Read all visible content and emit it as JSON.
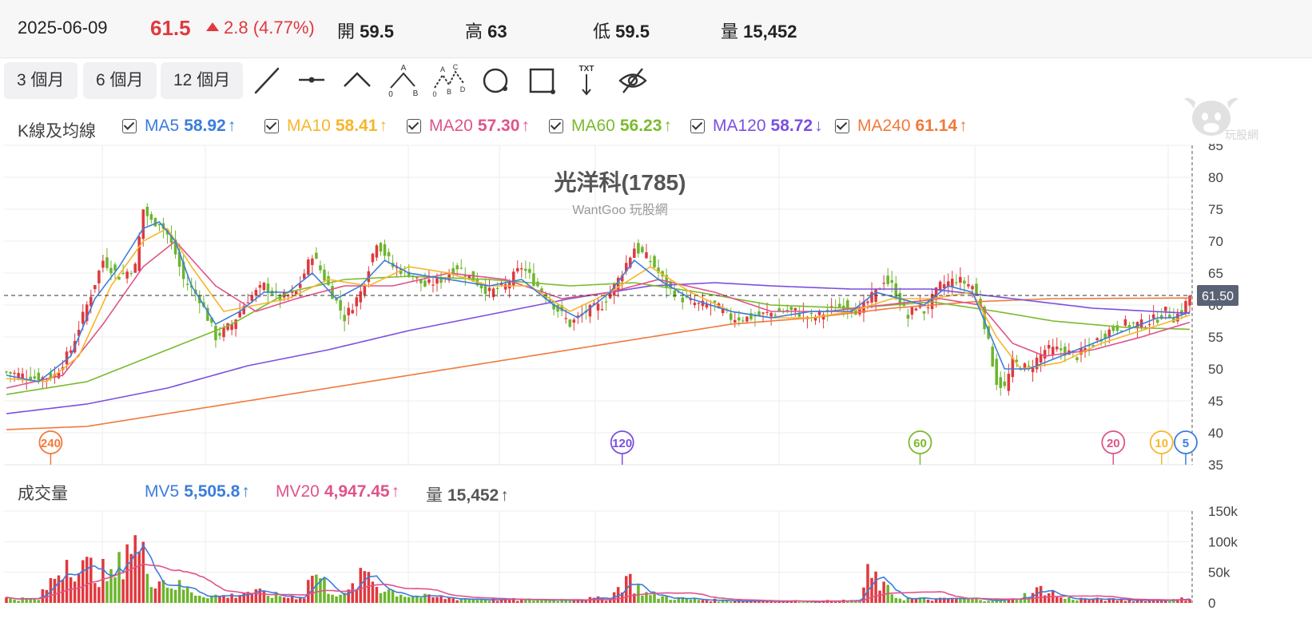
{
  "quote": {
    "date": "2025-06-09",
    "price": "61.5",
    "change": "2.8 (4.77%)",
    "open_label": "開",
    "open": "59.5",
    "high_label": "高",
    "high": "63",
    "low_label": "低",
    "low": "59.5",
    "volume_label": "量",
    "volume": "15,452"
  },
  "periods": [
    "3 個月",
    "6 個月",
    "12 個月"
  ],
  "tools": [
    "line-tool-icon",
    "horizontal-line-tool-icon",
    "angle-tool-icon",
    "abc-pattern-tool-icon",
    "abcd-pattern-tool-icon",
    "circle-tool-icon",
    "rectangle-tool-icon",
    "text-annotation-tool-icon",
    "hide-drawings-icon"
  ],
  "tool_text": {
    "a": "A",
    "b": "B",
    "c": "C",
    "d": "D",
    "zero": "0",
    "txt": "TXT"
  },
  "legend": {
    "title": "K線及均線",
    "items": [
      {
        "name": "MA5",
        "value": "58.92",
        "arrow": "↑",
        "color": "#3b7ddd"
      },
      {
        "name": "MA10",
        "value": "58.41",
        "arrow": "↑",
        "color": "#f5b72b"
      },
      {
        "name": "MA20",
        "value": "57.30",
        "arrow": "↑",
        "color": "#e0538b"
      },
      {
        "name": "MA60",
        "value": "56.23",
        "arrow": "↑",
        "color": "#7cba2f"
      },
      {
        "name": "MA120",
        "value": "58.72",
        "arrow": "↓",
        "color": "#7b4fe0"
      },
      {
        "name": "MA240",
        "value": "61.14",
        "arrow": "↑",
        "color": "#f07a3c"
      }
    ]
  },
  "watermark": {
    "title": "光洋科(1785)",
    "subtitle": "WantGoo 玩股網",
    "logo_text": "玩股網"
  },
  "colors": {
    "up": "#e0393e",
    "down": "#6cb52d",
    "grid": "#eeeeee",
    "price_tag_bg": "#5a6275"
  },
  "chart_data": {
    "type": "candlestick",
    "price_axis": {
      "ticks": [
        "85",
        "80",
        "75",
        "70",
        "65",
        "60",
        "55",
        "50",
        "45",
        "40",
        "35"
      ],
      "range": [
        35,
        85
      ]
    },
    "volume_axis": {
      "ticks": [
        "150k",
        "100k",
        "50k",
        "0"
      ],
      "range": [
        0,
        150000
      ]
    },
    "last_price_tag": "61.50",
    "ma_markers": [
      {
        "label": "240",
        "color": "#f07a3c"
      },
      {
        "label": "120",
        "color": "#7b4fe0"
      },
      {
        "label": "60",
        "color": "#7cba2f"
      },
      {
        "label": "20",
        "color": "#e0538b"
      },
      {
        "label": "10",
        "color": "#f5b72b"
      },
      {
        "label": "5",
        "color": "#3b7ddd"
      }
    ],
    "close_keypoints": [
      [
        0,
        49.5
      ],
      [
        8,
        48.5
      ],
      [
        12,
        49
      ],
      [
        16,
        53
      ],
      [
        20,
        60
      ],
      [
        24,
        67
      ],
      [
        28,
        64.5
      ],
      [
        32,
        66
      ],
      [
        34,
        75
      ],
      [
        36,
        73
      ],
      [
        38,
        73
      ],
      [
        40,
        71
      ],
      [
        42,
        68
      ],
      [
        44,
        64
      ],
      [
        48,
        61
      ],
      [
        52,
        55
      ],
      [
        56,
        57
      ],
      [
        60,
        61
      ],
      [
        64,
        63
      ],
      [
        68,
        61
      ],
      [
        72,
        62
      ],
      [
        76,
        68
      ],
      [
        80,
        63
      ],
      [
        84,
        58
      ],
      [
        88,
        62
      ],
      [
        92,
        70
      ],
      [
        96,
        66
      ],
      [
        100,
        65
      ],
      [
        104,
        63
      ],
      [
        108,
        64
      ],
      [
        112,
        66
      ],
      [
        116,
        64
      ],
      [
        120,
        62
      ],
      [
        124,
        63
      ],
      [
        128,
        66
      ],
      [
        132,
        63
      ],
      [
        136,
        60
      ],
      [
        140,
        57
      ],
      [
        144,
        59
      ],
      [
        148,
        60
      ],
      [
        152,
        64
      ],
      [
        156,
        69
      ],
      [
        160,
        67
      ],
      [
        164,
        63
      ],
      [
        168,
        61
      ],
      [
        172,
        60
      ],
      [
        176,
        60
      ],
      [
        180,
        58
      ],
      [
        184,
        58
      ],
      [
        188,
        58.5
      ],
      [
        192,
        59
      ],
      [
        196,
        59
      ],
      [
        200,
        58
      ],
      [
        204,
        59
      ],
      [
        208,
        60
      ],
      [
        212,
        59
      ],
      [
        216,
        62
      ],
      [
        218,
        64
      ],
      [
        220,
        63
      ],
      [
        224,
        58
      ],
      [
        226,
        60
      ],
      [
        228,
        59
      ],
      [
        232,
        63
      ],
      [
        236,
        64
      ],
      [
        240,
        63
      ],
      [
        242,
        60
      ],
      [
        244,
        54
      ],
      [
        246,
        48
      ],
      [
        248,
        47
      ],
      [
        250,
        51
      ],
      [
        254,
        50
      ],
      [
        258,
        53
      ],
      [
        262,
        53
      ],
      [
        266,
        52
      ],
      [
        270,
        54
      ],
      [
        274,
        56
      ],
      [
        278,
        57
      ],
      [
        282,
        57
      ],
      [
        286,
        58
      ],
      [
        288,
        59
      ],
      [
        290,
        58
      ],
      [
        292,
        59
      ],
      [
        294,
        61.5
      ]
    ],
    "ma5": [
      [
        0,
        49
      ],
      [
        8,
        48
      ],
      [
        16,
        52
      ],
      [
        22,
        61
      ],
      [
        28,
        66
      ],
      [
        34,
        72
      ],
      [
        38,
        73
      ],
      [
        42,
        70
      ],
      [
        46,
        63
      ],
      [
        52,
        57
      ],
      [
        58,
        59
      ],
      [
        64,
        62
      ],
      [
        70,
        62
      ],
      [
        76,
        65
      ],
      [
        82,
        61
      ],
      [
        88,
        63
      ],
      [
        94,
        67
      ],
      [
        100,
        65
      ],
      [
        110,
        64
      ],
      [
        120,
        63
      ],
      [
        128,
        64
      ],
      [
        136,
        60
      ],
      [
        142,
        58
      ],
      [
        150,
        62
      ],
      [
        156,
        67
      ],
      [
        162,
        64
      ],
      [
        170,
        61
      ],
      [
        180,
        59
      ],
      [
        190,
        58
      ],
      [
        200,
        59
      ],
      [
        210,
        59
      ],
      [
        216,
        62
      ],
      [
        222,
        61
      ],
      [
        228,
        60
      ],
      [
        234,
        63
      ],
      [
        240,
        62
      ],
      [
        244,
        56
      ],
      [
        248,
        50
      ],
      [
        254,
        50
      ],
      [
        262,
        52
      ],
      [
        270,
        54
      ],
      [
        278,
        56
      ],
      [
        286,
        58
      ],
      [
        290,
        58
      ],
      [
        294,
        58.9
      ]
    ],
    "ma10": [
      [
        0,
        48.5
      ],
      [
        10,
        48
      ],
      [
        18,
        52
      ],
      [
        26,
        63
      ],
      [
        34,
        70
      ],
      [
        40,
        72
      ],
      [
        46,
        66
      ],
      [
        54,
        59
      ],
      [
        62,
        60
      ],
      [
        70,
        61
      ],
      [
        80,
        64
      ],
      [
        90,
        63
      ],
      [
        100,
        66
      ],
      [
        110,
        65
      ],
      [
        120,
        63
      ],
      [
        130,
        63
      ],
      [
        140,
        59
      ],
      [
        150,
        62
      ],
      [
        160,
        66
      ],
      [
        170,
        62
      ],
      [
        180,
        59
      ],
      [
        190,
        58
      ],
      [
        200,
        58
      ],
      [
        210,
        59
      ],
      [
        220,
        61
      ],
      [
        230,
        61
      ],
      [
        240,
        62
      ],
      [
        246,
        55
      ],
      [
        252,
        50
      ],
      [
        262,
        51
      ],
      [
        272,
        54
      ],
      [
        282,
        56
      ],
      [
        294,
        58.4
      ]
    ],
    "ma20": [
      [
        0,
        47
      ],
      [
        14,
        49
      ],
      [
        24,
        57
      ],
      [
        34,
        66
      ],
      [
        42,
        70
      ],
      [
        52,
        63
      ],
      [
        62,
        59
      ],
      [
        72,
        61
      ],
      [
        84,
        63
      ],
      [
        96,
        63
      ],
      [
        110,
        65
      ],
      [
        124,
        64
      ],
      [
        138,
        61
      ],
      [
        150,
        62
      ],
      [
        162,
        64
      ],
      [
        176,
        62
      ],
      [
        190,
        59
      ],
      [
        204,
        59
      ],
      [
        218,
        60
      ],
      [
        232,
        61
      ],
      [
        242,
        60
      ],
      [
        250,
        54
      ],
      [
        258,
        52
      ],
      [
        270,
        53
      ],
      [
        282,
        55
      ],
      [
        294,
        57.3
      ]
    ],
    "ma60": [
      [
        0,
        46
      ],
      [
        20,
        48
      ],
      [
        40,
        53
      ],
      [
        56,
        57
      ],
      [
        70,
        62
      ],
      [
        84,
        64
      ],
      [
        100,
        64.5
      ],
      [
        120,
        64
      ],
      [
        140,
        63
      ],
      [
        156,
        63.5
      ],
      [
        172,
        62
      ],
      [
        190,
        60
      ],
      [
        210,
        59.5
      ],
      [
        230,
        60.5
      ],
      [
        246,
        59
      ],
      [
        260,
        57.5
      ],
      [
        278,
        56.5
      ],
      [
        294,
        56.2
      ]
    ],
    "ma120": [
      [
        0,
        43
      ],
      [
        20,
        44.5
      ],
      [
        40,
        47
      ],
      [
        60,
        50.5
      ],
      [
        80,
        53
      ],
      [
        100,
        56
      ],
      [
        120,
        58.5
      ],
      [
        140,
        61
      ],
      [
        160,
        63
      ],
      [
        176,
        63.5
      ],
      [
        190,
        63
      ],
      [
        210,
        62.5
      ],
      [
        230,
        62.5
      ],
      [
        250,
        61
      ],
      [
        270,
        59.5
      ],
      [
        294,
        58.7
      ]
    ],
    "ma240": [
      [
        0,
        40.5
      ],
      [
        20,
        41
      ],
      [
        40,
        43
      ],
      [
        60,
        45
      ],
      [
        80,
        47
      ],
      [
        100,
        49
      ],
      [
        120,
        51
      ],
      [
        140,
        53
      ],
      [
        160,
        55
      ],
      [
        180,
        57
      ],
      [
        200,
        58
      ],
      [
        220,
        59.5
      ],
      [
        240,
        60.5
      ],
      [
        260,
        61
      ],
      [
        294,
        61.1
      ]
    ],
    "volume_keypoints": [
      [
        0,
        8000
      ],
      [
        8,
        6000
      ],
      [
        12,
        45000
      ],
      [
        16,
        90000
      ],
      [
        18,
        55000
      ],
      [
        22,
        60000
      ],
      [
        26,
        40000
      ],
      [
        28,
        60000
      ],
      [
        30,
        110000
      ],
      [
        32,
        100000
      ],
      [
        34,
        75000
      ],
      [
        36,
        50000
      ],
      [
        40,
        35000
      ],
      [
        44,
        25000
      ],
      [
        48,
        15000
      ],
      [
        52,
        12000
      ],
      [
        56,
        12000
      ],
      [
        60,
        20000
      ],
      [
        64,
        15000
      ],
      [
        70,
        10000
      ],
      [
        74,
        12000
      ],
      [
        76,
        55000
      ],
      [
        78,
        40000
      ],
      [
        80,
        25000
      ],
      [
        84,
        12000
      ],
      [
        88,
        40000
      ],
      [
        90,
        55000
      ],
      [
        92,
        30000
      ],
      [
        96,
        20000
      ],
      [
        100,
        12000
      ],
      [
        110,
        8000
      ],
      [
        120,
        6000
      ],
      [
        130,
        5000
      ],
      [
        140,
        6000
      ],
      [
        150,
        8000
      ],
      [
        152,
        25000
      ],
      [
        154,
        45000
      ],
      [
        156,
        30000
      ],
      [
        160,
        12000
      ],
      [
        170,
        6000
      ],
      [
        180,
        4000
      ],
      [
        200,
        3000
      ],
      [
        212,
        4000
      ],
      [
        214,
        45000
      ],
      [
        216,
        40000
      ],
      [
        218,
        25000
      ],
      [
        222,
        8000
      ],
      [
        230,
        6000
      ],
      [
        240,
        7000
      ],
      [
        246,
        5000
      ],
      [
        250,
        6000
      ],
      [
        256,
        20000
      ],
      [
        258,
        25000
      ],
      [
        262,
        8000
      ],
      [
        270,
        6000
      ],
      [
        280,
        5000
      ],
      [
        290,
        5000
      ],
      [
        294,
        8000
      ]
    ],
    "volume_legend": [
      {
        "name": "MV5",
        "value": "5,505.8",
        "arrow": "↑",
        "color": "#3b7ddd"
      },
      {
        "name": "MV20",
        "value": "4,947.45",
        "arrow": "↑",
        "color": "#e0538b"
      },
      {
        "name": "量",
        "value": "15,452",
        "arrow": "↑",
        "color": "#555555"
      }
    ]
  },
  "volume_legend_title": "成交量"
}
